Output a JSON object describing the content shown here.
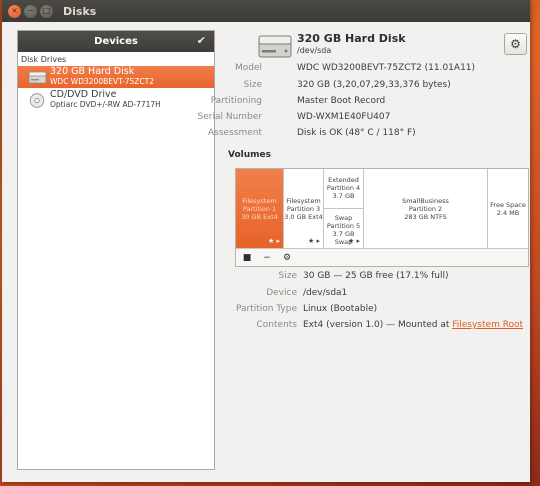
{
  "window": {
    "title": "Disks",
    "buttons": {
      "close": "×",
      "minimize": "−",
      "maximize": "□"
    }
  },
  "sidebar": {
    "header": "Devices",
    "header_icon": "checkmark-icon",
    "section": "Disk Drives",
    "drives": [
      {
        "name": "320 GB Hard Disk",
        "model": "WDC WD3200BEVT-75ZCT2",
        "icon": "hard-disk-icon",
        "selected": true
      },
      {
        "name": "CD/DVD Drive",
        "model": "Optiarc DVD+/-RW AD-7717H",
        "icon": "optical-disc-icon",
        "selected": false
      }
    ]
  },
  "disk": {
    "title": "320 GB Hard Disk",
    "device": "/dev/sda",
    "properties": [
      {
        "label": "Model",
        "value": "WDC WD3200BEVT-75ZCT2 (11.01A11)"
      },
      {
        "label": "Size",
        "value": "320 GB (3,20,07,29,33,376 bytes)"
      },
      {
        "label": "Partitioning",
        "value": "Master Boot Record"
      },
      {
        "label": "Serial Number",
        "value": "WD-WXM1E40FU407"
      },
      {
        "label": "Assessment",
        "value": "Disk is OK (48° C / 118° F)"
      }
    ]
  },
  "volumes": {
    "heading": "Volumes",
    "partitions": [
      {
        "lines": [
          "Filesystem",
          "Partition 1",
          "30 GB Ext4"
        ],
        "icons": "★ ▸",
        "selected": true
      },
      {
        "lines": [
          "Filesystem",
          "Partition 3",
          "3.0 GB Ext4"
        ],
        "icons": "★ ▸",
        "selected": false
      },
      {
        "lines": [
          "Extended",
          "Partition 4",
          "3.7 GB"
        ],
        "icons": "",
        "selected": false
      },
      {
        "lines": [
          "Swap",
          "Partition 5",
          "3.7 GB Swap"
        ],
        "icons": "★ ▸",
        "selected": false
      },
      {
        "lines": [
          "SmallBusiness",
          "Partition 2",
          "283 GB NTFS"
        ],
        "icons": "",
        "selected": false
      },
      {
        "lines": [
          "Free Space",
          "2.4 MB"
        ],
        "icons": "",
        "selected": false
      }
    ],
    "toolbar": {
      "stop": "■",
      "delete": "−",
      "more": "⚙"
    }
  },
  "partition_details": [
    {
      "label": "Size",
      "value": "30 GB — 25 GB free (17.1% full)"
    },
    {
      "label": "Device",
      "value": "/dev/sda1"
    },
    {
      "label": "Partition Type",
      "value": "Linux (Bootable)"
    },
    {
      "label": "Contents",
      "value": "Ext4 (version 1.0) — Mounted at ",
      "link": "Filesystem Root"
    }
  ],
  "colors": {
    "accent": "#e9642c",
    "titlebar": "#3c3b37",
    "link": "#e05d22"
  }
}
